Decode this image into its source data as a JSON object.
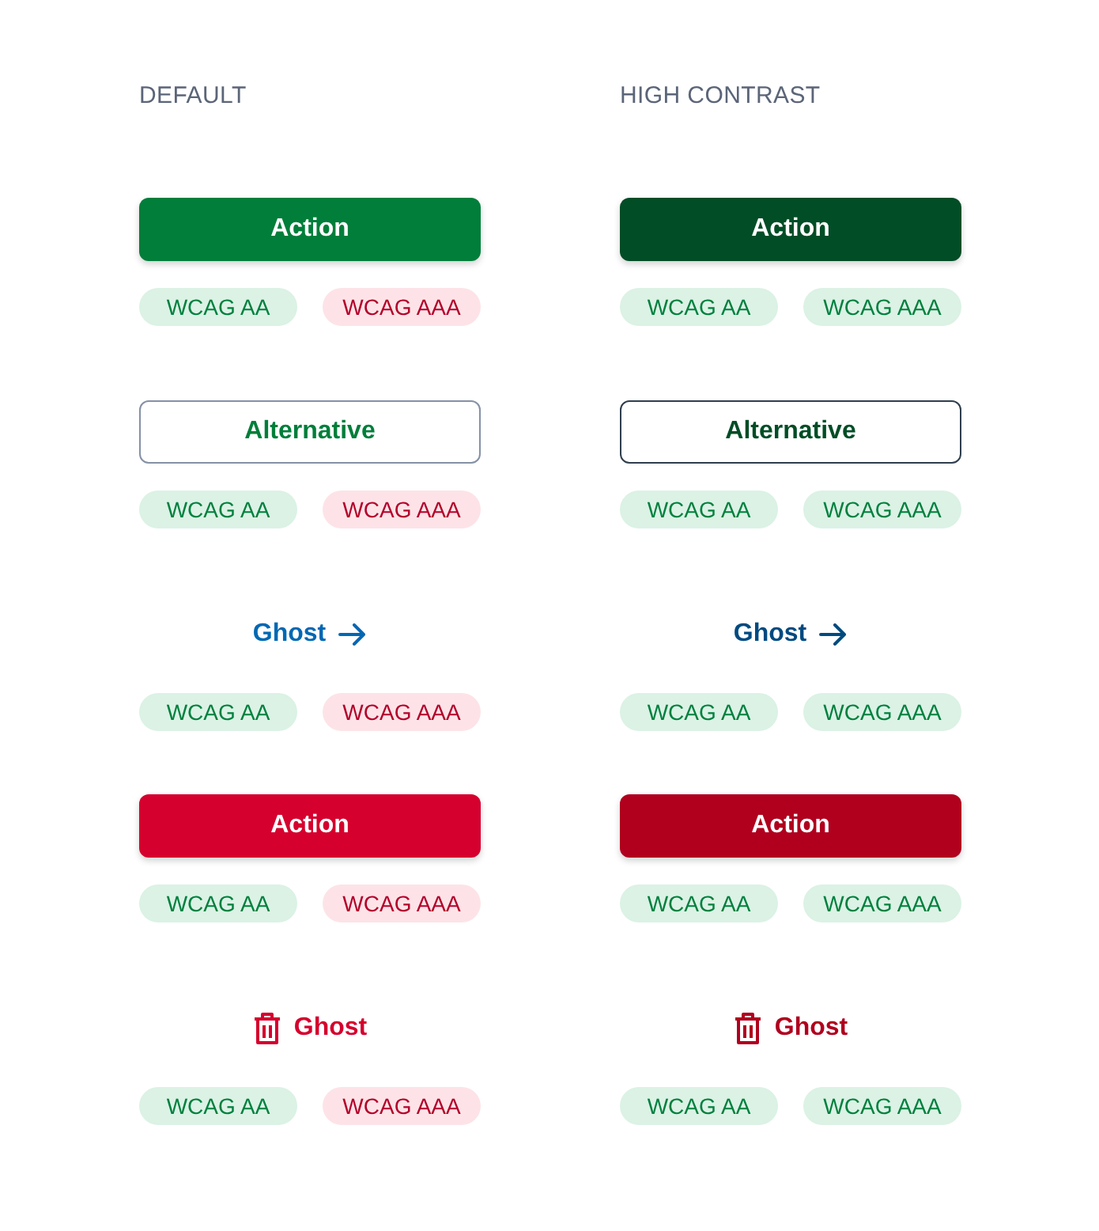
{
  "columns": [
    {
      "heading": "DEFAULT",
      "high_contrast": false,
      "buttons": [
        {
          "kind": "solid",
          "label": "Action",
          "badges": [
            {
              "label": "WCAG AA",
              "pass": true
            },
            {
              "label": "WCAG AAA",
              "pass": false
            }
          ]
        },
        {
          "kind": "outline",
          "label": "Alternative",
          "badges": [
            {
              "label": "WCAG AA",
              "pass": true
            },
            {
              "label": "WCAG AAA",
              "pass": false
            }
          ]
        },
        {
          "kind": "ghost-arrow",
          "label": "Ghost",
          "badges": [
            {
              "label": "WCAG AA",
              "pass": true
            },
            {
              "label": "WCAG AAA",
              "pass": false
            }
          ]
        },
        {
          "kind": "danger",
          "label": "Action",
          "badges": [
            {
              "label": "WCAG AA",
              "pass": true
            },
            {
              "label": "WCAG AAA",
              "pass": false
            }
          ]
        },
        {
          "kind": "ghost-delete",
          "label": "Ghost",
          "badges": [
            {
              "label": "WCAG AA",
              "pass": true
            },
            {
              "label": "WCAG AAA",
              "pass": false
            }
          ]
        }
      ]
    },
    {
      "heading": "HIGH CONTRAST",
      "high_contrast": true,
      "buttons": [
        {
          "kind": "solid",
          "label": "Action",
          "badges": [
            {
              "label": "WCAG AA",
              "pass": true
            },
            {
              "label": "WCAG AAA",
              "pass": true
            }
          ]
        },
        {
          "kind": "outline",
          "label": "Alternative",
          "badges": [
            {
              "label": "WCAG AA",
              "pass": true
            },
            {
              "label": "WCAG AAA",
              "pass": true
            }
          ]
        },
        {
          "kind": "ghost-arrow",
          "label": "Ghost",
          "badges": [
            {
              "label": "WCAG AA",
              "pass": true
            },
            {
              "label": "WCAG AAA",
              "pass": true
            }
          ]
        },
        {
          "kind": "danger",
          "label": "Action",
          "badges": [
            {
              "label": "WCAG AA",
              "pass": true
            },
            {
              "label": "WCAG AAA",
              "pass": true
            }
          ]
        },
        {
          "kind": "ghost-delete",
          "label": "Ghost",
          "badges": [
            {
              "label": "WCAG AA",
              "pass": true
            },
            {
              "label": "WCAG AAA",
              "pass": true
            }
          ]
        }
      ]
    }
  ]
}
